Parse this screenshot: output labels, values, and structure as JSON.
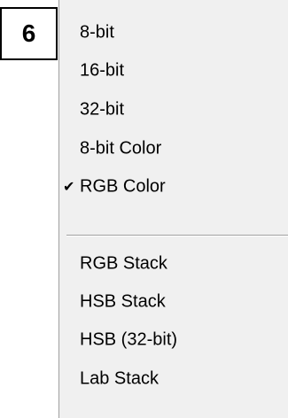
{
  "step_number": "6",
  "menu": {
    "items": [
      {
        "label": "8-bit",
        "checked": false
      },
      {
        "label": "16-bit",
        "checked": false
      },
      {
        "label": "32-bit",
        "checked": false
      },
      {
        "label": "8-bit Color",
        "checked": false
      },
      {
        "label": "RGB Color",
        "checked": true
      },
      {
        "label": "RGB Stack",
        "checked": false
      },
      {
        "label": "HSB Stack",
        "checked": false
      },
      {
        "label": "HSB (32-bit)",
        "checked": false
      },
      {
        "label": "Lab Stack",
        "checked": false
      }
    ],
    "check_glyph": "✔"
  },
  "colors": {
    "menu_background": "#f0f0f0",
    "text": "#000000",
    "separator": "#a0a0a0"
  }
}
